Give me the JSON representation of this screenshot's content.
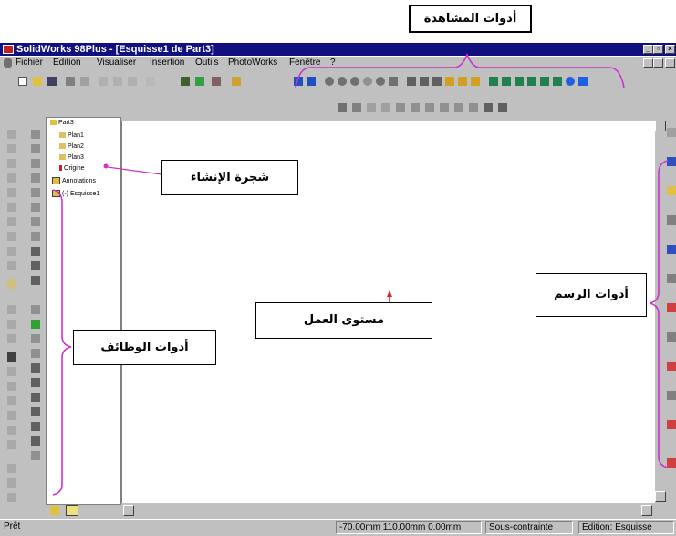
{
  "window": {
    "title": "SolidWorks 98Plus - [Esquisse1 de Part3]",
    "min_label": "_",
    "max_label": "▫",
    "close_label": "×"
  },
  "menu": {
    "items": [
      "Fichier",
      "Edition",
      "Visualiser",
      "Insertion",
      "Outils",
      "PhotoWorks",
      "Fenêtre",
      "?"
    ]
  },
  "tree": {
    "root": "Part3",
    "items": [
      "Plan1",
      "Plan2",
      "Plan3",
      "Origine",
      "Annotations",
      "(-) Esquisse1"
    ]
  },
  "callouts": {
    "view_tools": "أدوات المشاهدة",
    "feature_tree": "شجرة الإنشاء",
    "work_plane": "مستوى العمل",
    "sketch_tools": "أدوات الرسم",
    "feature_tools": "أدوات الوظائف"
  },
  "status": {
    "ready": "Prêt",
    "coords": "-70.00mm 110.00mm 0.00mm",
    "constraint": "Sous-contrainte",
    "edition": "Edition: Esquisse"
  },
  "colors": {
    "title_bar": "#10107f",
    "chrome": "#c0c0c0",
    "callout_brace": "#cc33cc",
    "origin_arrow": "#e02020"
  }
}
